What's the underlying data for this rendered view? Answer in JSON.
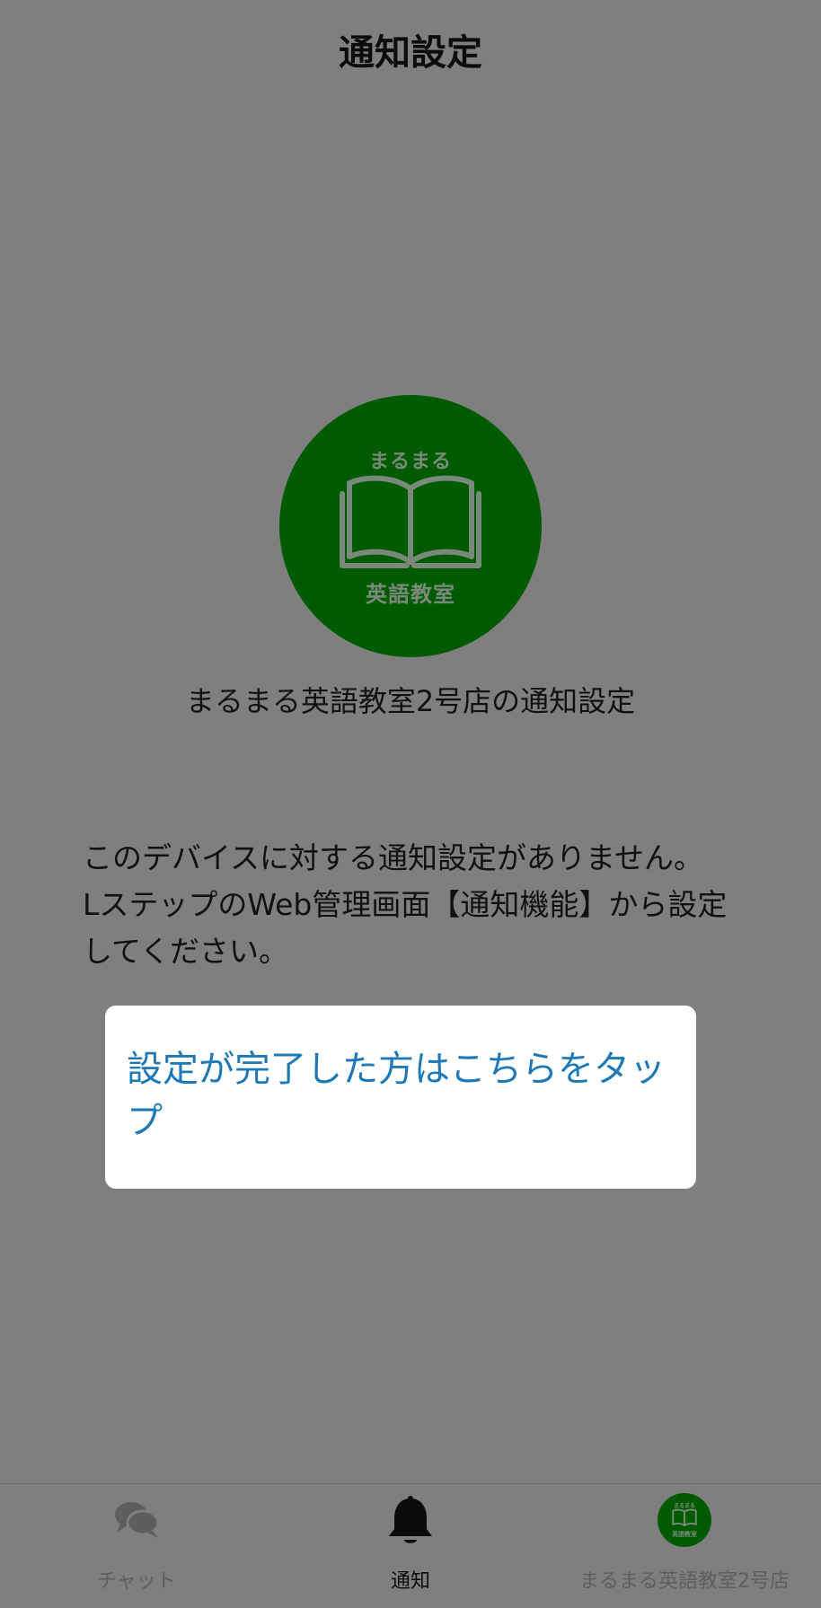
{
  "header": {
    "title": "通知設定"
  },
  "account": {
    "logo_top_text": "まるまる",
    "logo_bottom_text": "英語教室",
    "settings_title": "まるまる英語教室2号店の通知設定",
    "brand_color": "#005a00"
  },
  "notice": {
    "line1": "このデバイスに対する通知設定がありません。",
    "line2": "LステップのWeb管理画面【通知機能】から設定してください。"
  },
  "done_button": {
    "label": "設定が完了した方はこちらをタップ",
    "color": "#1f79b6"
  },
  "tabbar": {
    "tabs": [
      {
        "label": "チャット",
        "icon": "chat-bubbles-icon",
        "active": false
      },
      {
        "label": "通知",
        "icon": "bell-icon",
        "active": true
      },
      {
        "label": "まるまる英語教室2号店",
        "icon": "account-avatar",
        "active": false
      }
    ]
  }
}
